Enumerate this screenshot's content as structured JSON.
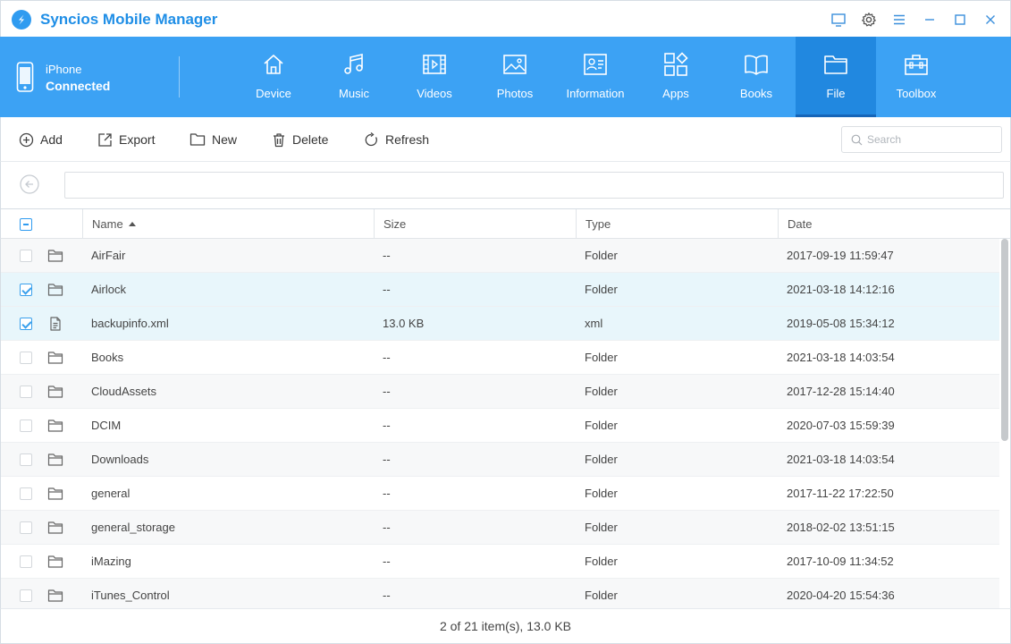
{
  "app": {
    "title": "Syncios Mobile Manager",
    "accent_color": "#3ca2f4",
    "window_controls": [
      "feedback-icon",
      "gear-icon",
      "menu-icon",
      "minimize-icon",
      "maximize-icon",
      "close-icon"
    ]
  },
  "device": {
    "name": "iPhone",
    "status": "Connected",
    "icon": "phone-icon"
  },
  "nav": {
    "active": "File",
    "tabs": [
      {
        "label": "Device",
        "icon": "home-icon"
      },
      {
        "label": "Music",
        "icon": "music-note-icon"
      },
      {
        "label": "Videos",
        "icon": "film-icon"
      },
      {
        "label": "Photos",
        "icon": "image-icon"
      },
      {
        "label": "Information",
        "icon": "contact-card-icon"
      },
      {
        "label": "Apps",
        "icon": "apps-grid-icon"
      },
      {
        "label": "Books",
        "icon": "book-icon"
      },
      {
        "label": "File",
        "icon": "folder-icon"
      },
      {
        "label": "Toolbox",
        "icon": "toolbox-icon"
      }
    ]
  },
  "toolbar": {
    "add_label": "Add",
    "export_label": "Export",
    "new_label": "New",
    "delete_label": "Delete",
    "refresh_label": "Refresh",
    "search_placeholder": "Search"
  },
  "path": {
    "value": ""
  },
  "table": {
    "columns": {
      "name": "Name",
      "size": "Size",
      "type": "Type",
      "date": "Date"
    },
    "sort": {
      "column": "name",
      "direction": "ascending"
    },
    "rows": [
      {
        "name": "AirFair",
        "size": "--",
        "type": "Folder",
        "date": "2017-09-19 11:59:47",
        "icon": "folder",
        "selected": false
      },
      {
        "name": "Airlock",
        "size": "--",
        "type": "Folder",
        "date": "2021-03-18 14:12:16",
        "icon": "folder",
        "selected": true
      },
      {
        "name": "backupinfo.xml",
        "size": "13.0 KB",
        "type": "xml",
        "date": "2019-05-08 15:34:12",
        "icon": "file",
        "selected": true
      },
      {
        "name": "Books",
        "size": "--",
        "type": "Folder",
        "date": "2021-03-18 14:03:54",
        "icon": "folder",
        "selected": false
      },
      {
        "name": "CloudAssets",
        "size": "--",
        "type": "Folder",
        "date": "2017-12-28 15:14:40",
        "icon": "folder",
        "selected": false
      },
      {
        "name": "DCIM",
        "size": "--",
        "type": "Folder",
        "date": "2020-07-03 15:59:39",
        "icon": "folder",
        "selected": false
      },
      {
        "name": "Downloads",
        "size": "--",
        "type": "Folder",
        "date": "2021-03-18 14:03:54",
        "icon": "folder",
        "selected": false
      },
      {
        "name": "general",
        "size": "--",
        "type": "Folder",
        "date": "2017-11-22 17:22:50",
        "icon": "folder",
        "selected": false
      },
      {
        "name": "general_storage",
        "size": "--",
        "type": "Folder",
        "date": "2018-02-02 13:51:15",
        "icon": "folder",
        "selected": false
      },
      {
        "name": "iMazing",
        "size": "--",
        "type": "Folder",
        "date": "2017-10-09 11:34:52",
        "icon": "folder",
        "selected": false
      },
      {
        "name": "iTunes_Control",
        "size": "--",
        "type": "Folder",
        "date": "2020-04-20 15:54:36",
        "icon": "folder",
        "selected": false
      }
    ]
  },
  "status": {
    "text": "2 of 21 item(s), 13.0 KB"
  }
}
